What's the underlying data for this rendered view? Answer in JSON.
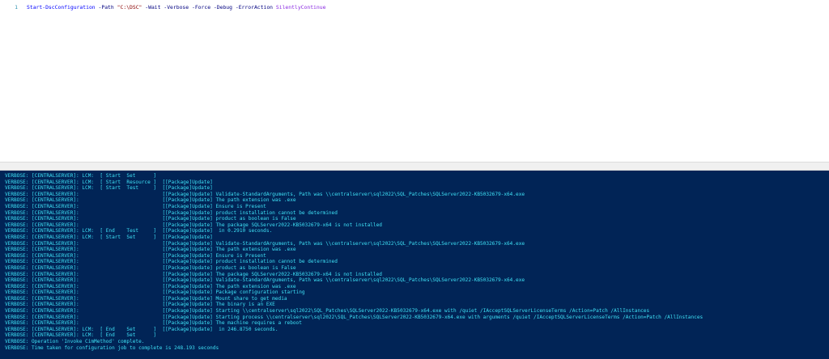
{
  "editor": {
    "line_number": "1",
    "tokens": {
      "cmdlet": "Start-DscConfiguration",
      "path_param": "-Path",
      "path_value": "\"C:\\DSC\"",
      "flags": "-Wait -Verbose -Force -Debug",
      "erroraction_param": "-ErrorAction",
      "erroraction_value": "SilentlyContinue"
    }
  },
  "console": {
    "lines": [
      "VERBOSE: [CENTRALSERVER]: LCM:  [ Start  Set      ]",
      "VERBOSE: [CENTRALSERVER]: LCM:  [ Start  Resource ]  [[Package]Update]",
      "VERBOSE: [CENTRALSERVER]: LCM:  [ Start  Test     ]  [[Package]Update]",
      "VERBOSE: [CENTRALSERVER]:                            [[Package]Update] Validate-StandardArguments, Path was \\\\centralserver\\sql2022\\SQL_Patches\\SQLServer2022-KB5032679-x64.exe",
      "VERBOSE: [CENTRALSERVER]:                            [[Package]Update] The path extension was .exe",
      "VERBOSE: [CENTRALSERVER]:                            [[Package]Update] Ensure is Present",
      "VERBOSE: [CENTRALSERVER]:                            [[Package]Update] product installation cannot be determined",
      "VERBOSE: [CENTRALSERVER]:                            [[Package]Update] product as boolean is False",
      "VERBOSE: [CENTRALSERVER]:                            [[Package]Update] The package SQLServer2022-KB5032679-x64 is not installed",
      "VERBOSE: [CENTRALSERVER]: LCM:  [ End    Test     ]  [[Package]Update]  in 0.2910 seconds.",
      "VERBOSE: [CENTRALSERVER]: LCM:  [ Start  Set      ]  [[Package]Update]",
      "VERBOSE: [CENTRALSERVER]:                            [[Package]Update] Validate-StandardArguments, Path was \\\\centralserver\\sql2022\\SQL_Patches\\SQLServer2022-KB5032679-x64.exe",
      "VERBOSE: [CENTRALSERVER]:                            [[Package]Update] The path extension was .exe",
      "VERBOSE: [CENTRALSERVER]:                            [[Package]Update] Ensure is Present",
      "VERBOSE: [CENTRALSERVER]:                            [[Package]Update] product installation cannot be determined",
      "VERBOSE: [CENTRALSERVER]:                            [[Package]Update] product as boolean is False",
      "VERBOSE: [CENTRALSERVER]:                            [[Package]Update] The package SQLServer2022-KB5032679-x64 is not installed",
      "VERBOSE: [CENTRALSERVER]:                            [[Package]Update] Validate-StandardArguments, Path was \\\\centralserver\\sql2022\\SQL_Patches\\SQLServer2022-KB5032679-x64.exe",
      "VERBOSE: [CENTRALSERVER]:                            [[Package]Update] The path extension was .exe",
      "VERBOSE: [CENTRALSERVER]:                            [[Package]Update] Package configuration starting",
      "VERBOSE: [CENTRALSERVER]:                            [[Package]Update] Mount share to get media",
      "VERBOSE: [CENTRALSERVER]:                            [[Package]Update] The binary is an EXE",
      "VERBOSE: [CENTRALSERVER]:                            [[Package]Update] Starting \\\\centralserver\\sql2022\\SQL_Patches\\SQLServer2022-KB5032679-x64.exe with /quiet /IAcceptSQLServerLicenseTerms /Action=Patch /AllInstances",
      "VERBOSE: [CENTRALSERVER]:                            [[Package]Update] Starting process \\\\centralserver\\sql2022\\SQL_Patches\\SQLServer2022-KB5032679-x64.exe with arguments /quiet /IAcceptSQLServerLicenseTerms /Action=Patch /AllInstances",
      "VERBOSE: [CENTRALSERVER]:                            [[Package]Update] The machine requires a reboot",
      "VERBOSE: [CENTRALSERVER]: LCM:  [ End    Set      ]  [[Package]Update]  in 246.8750 seconds.",
      "VERBOSE: [CENTRALSERVER]: LCM:  [ End    Set      ]",
      "VERBOSE: Operation 'Invoke CimMethod' complete.",
      "VERBOSE: Time taken for configuration job to complete is 248.193 seconds"
    ]
  }
}
